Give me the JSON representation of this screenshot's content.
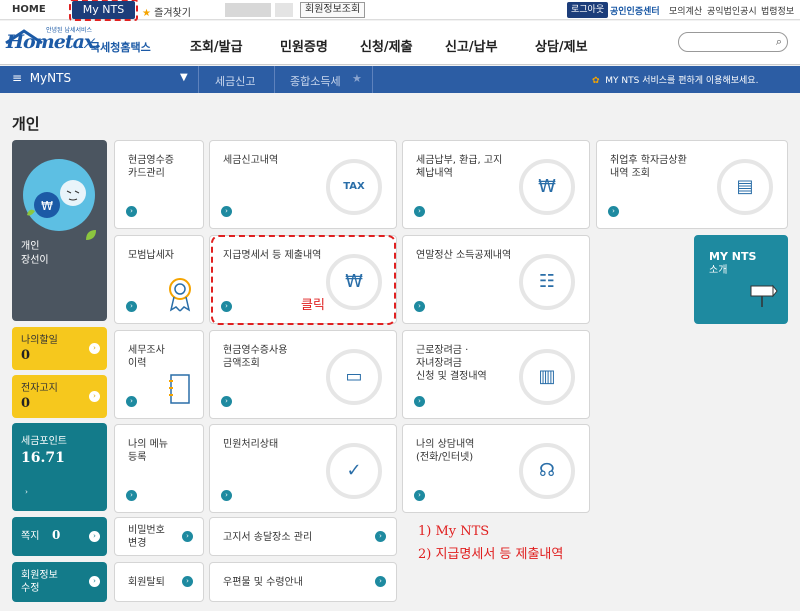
{
  "topbar": {
    "home": "HOME",
    "my_nts": "My NTS",
    "favorites": "즐겨찾기",
    "member_info": "회원정보조회",
    "logout": "로그아웃",
    "cert_center": "공인인증센터",
    "mock_calc": "모의계산",
    "public_notice": "공익법인공시",
    "legal_info": "법령정보"
  },
  "logo": {
    "small": "안녕된 납세서비스",
    "brand": "Hometax.",
    "kr": "국세청홈택스"
  },
  "nav": [
    "조회/발급",
    "민원증명",
    "신청/제출",
    "신고/납부",
    "상담/제보"
  ],
  "bluebar": {
    "menu": "MyNTS",
    "crumbs": [
      "세금신고",
      "종합소득세"
    ],
    "notice": "MY NTS 서비스를 편하게 이용해보세요."
  },
  "page_title": "개인",
  "profile": {
    "label_line1": "개인",
    "label_line2": "장선이"
  },
  "side_items": {
    "todo": {
      "label": "나의할일",
      "value": "0"
    },
    "e_notice": {
      "label": "전자고지",
      "value": "0"
    },
    "tax_points": {
      "label": "세금포인트",
      "value": "16.71"
    },
    "memo": {
      "label": "쪽지",
      "value": "0"
    },
    "member_edit": {
      "label_line1": "회원정보",
      "label_line2": "수정"
    }
  },
  "tiles": {
    "cash_receipt": {
      "line1": "현금영수증",
      "line2": "카드관리"
    },
    "tax_return_history": {
      "line1": "세금신고내역"
    },
    "payment": {
      "line1": "세금납부, 환급, 고지",
      "line2": "체납내역"
    },
    "student_loan": {
      "line1": "취업후 학자금상환",
      "line2": "내역 조회"
    },
    "model_taxpayer": {
      "line1": "모범납세자"
    },
    "payment_statement": {
      "line1": "지급명세서 등 제출내역"
    },
    "year_end": {
      "line1": "연말정산 소득공제내역"
    },
    "mynts_intro": {
      "line1": "MY NTS",
      "line2": "소개"
    },
    "tax_audit": {
      "line1": "세무조사",
      "line2": "이력"
    },
    "cash_receipt_usage": {
      "line1": "현금영수증사용",
      "line2": "금액조회"
    },
    "earned_income": {
      "line1": "근로장려금 ·",
      "line2": "자녀장려금",
      "line3": "신청 및 결정내역"
    },
    "my_menu": {
      "line1": "나의 메뉴",
      "line2": "등록"
    },
    "civil_status": {
      "line1": "민원처리상태"
    },
    "consult_history": {
      "line1": "나의 상담내역",
      "line2": "(전화/인터넷)"
    },
    "password_change": {
      "line1": "비밀번호",
      "line2": "변경"
    },
    "notice_address": {
      "line1": "고지서 송달장소 관리"
    },
    "withdraw": {
      "line1": "회원탈퇴"
    },
    "mail_guide": {
      "line1": "우편물 및 수령안내"
    }
  },
  "annotations": {
    "click": "클릭",
    "step1": "1) My NTS",
    "step2": "2) 지급명세서 등 제출내역"
  },
  "colors": {
    "navy": "#1c3d7a",
    "blue_bar": "#2c5da4",
    "teal": "#1e8aa0",
    "yellow": "#f6c81d",
    "highlight": "#e02020"
  },
  "icons": [
    "star-icon",
    "search-icon",
    "hamburger-icon",
    "chevron-down-icon",
    "tax-document-icon",
    "won-coin-icon",
    "book-icon",
    "award-badge-icon",
    "won-document-icon",
    "table-document-icon",
    "signpost-icon",
    "notebook-icon",
    "receipt-icon",
    "open-book-icon",
    "check-circle-icon",
    "headset-icon",
    "arrow-circle-icon"
  ]
}
